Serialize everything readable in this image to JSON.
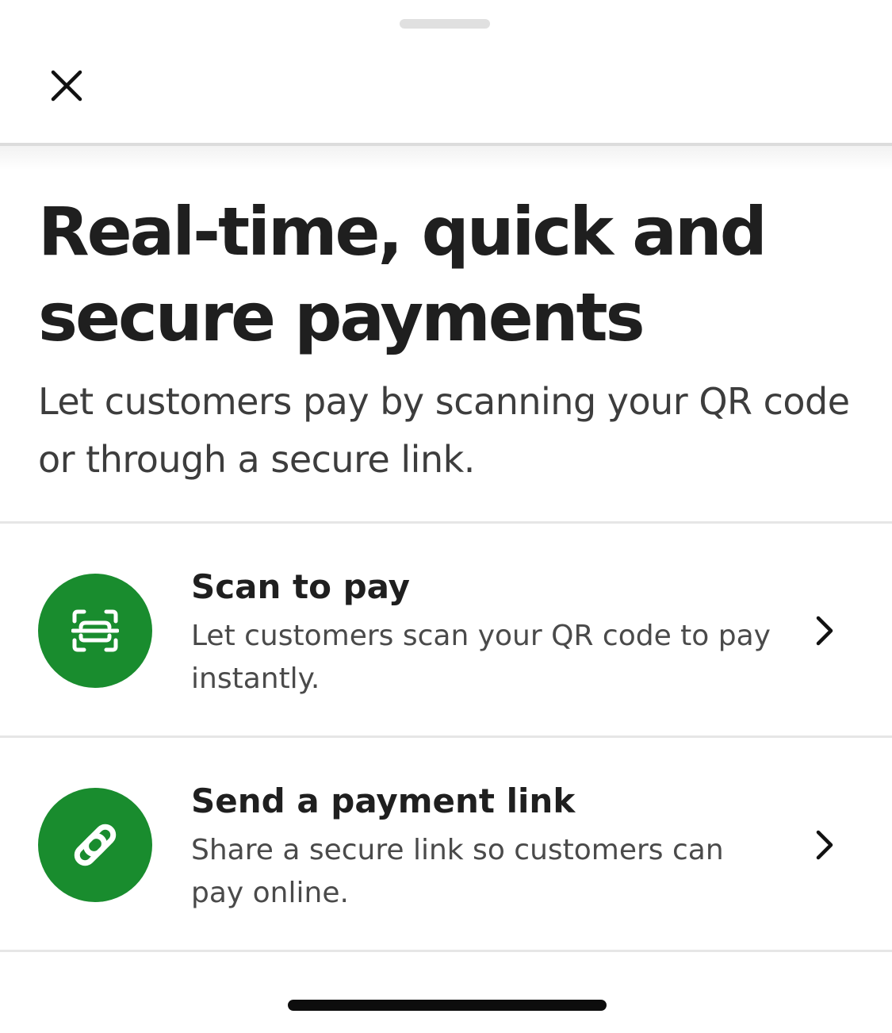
{
  "sheet": {
    "grabber_icon": "drag-handle"
  },
  "header": {
    "close_icon": "close-x-icon"
  },
  "intro": {
    "title": "Real-time, quick and secure payments",
    "subtitle": "Let customers pay by scanning your QR code or through a secure link."
  },
  "options": [
    {
      "icon": "qr-scan-icon",
      "title": "Scan to pay",
      "description": "Let customers scan your QR code to pay instantly.",
      "chevron_icon": "chevron-right-icon"
    },
    {
      "icon": "link-icon",
      "title": "Send a payment link",
      "description": "Share a secure link so customers can pay online.",
      "chevron_icon": "chevron-right-icon"
    }
  ],
  "colors": {
    "accent_green": "#198c2e",
    "title_text": "#1f1f1f",
    "body_text": "#3d3d3d",
    "divider": "#e6e6e6"
  }
}
